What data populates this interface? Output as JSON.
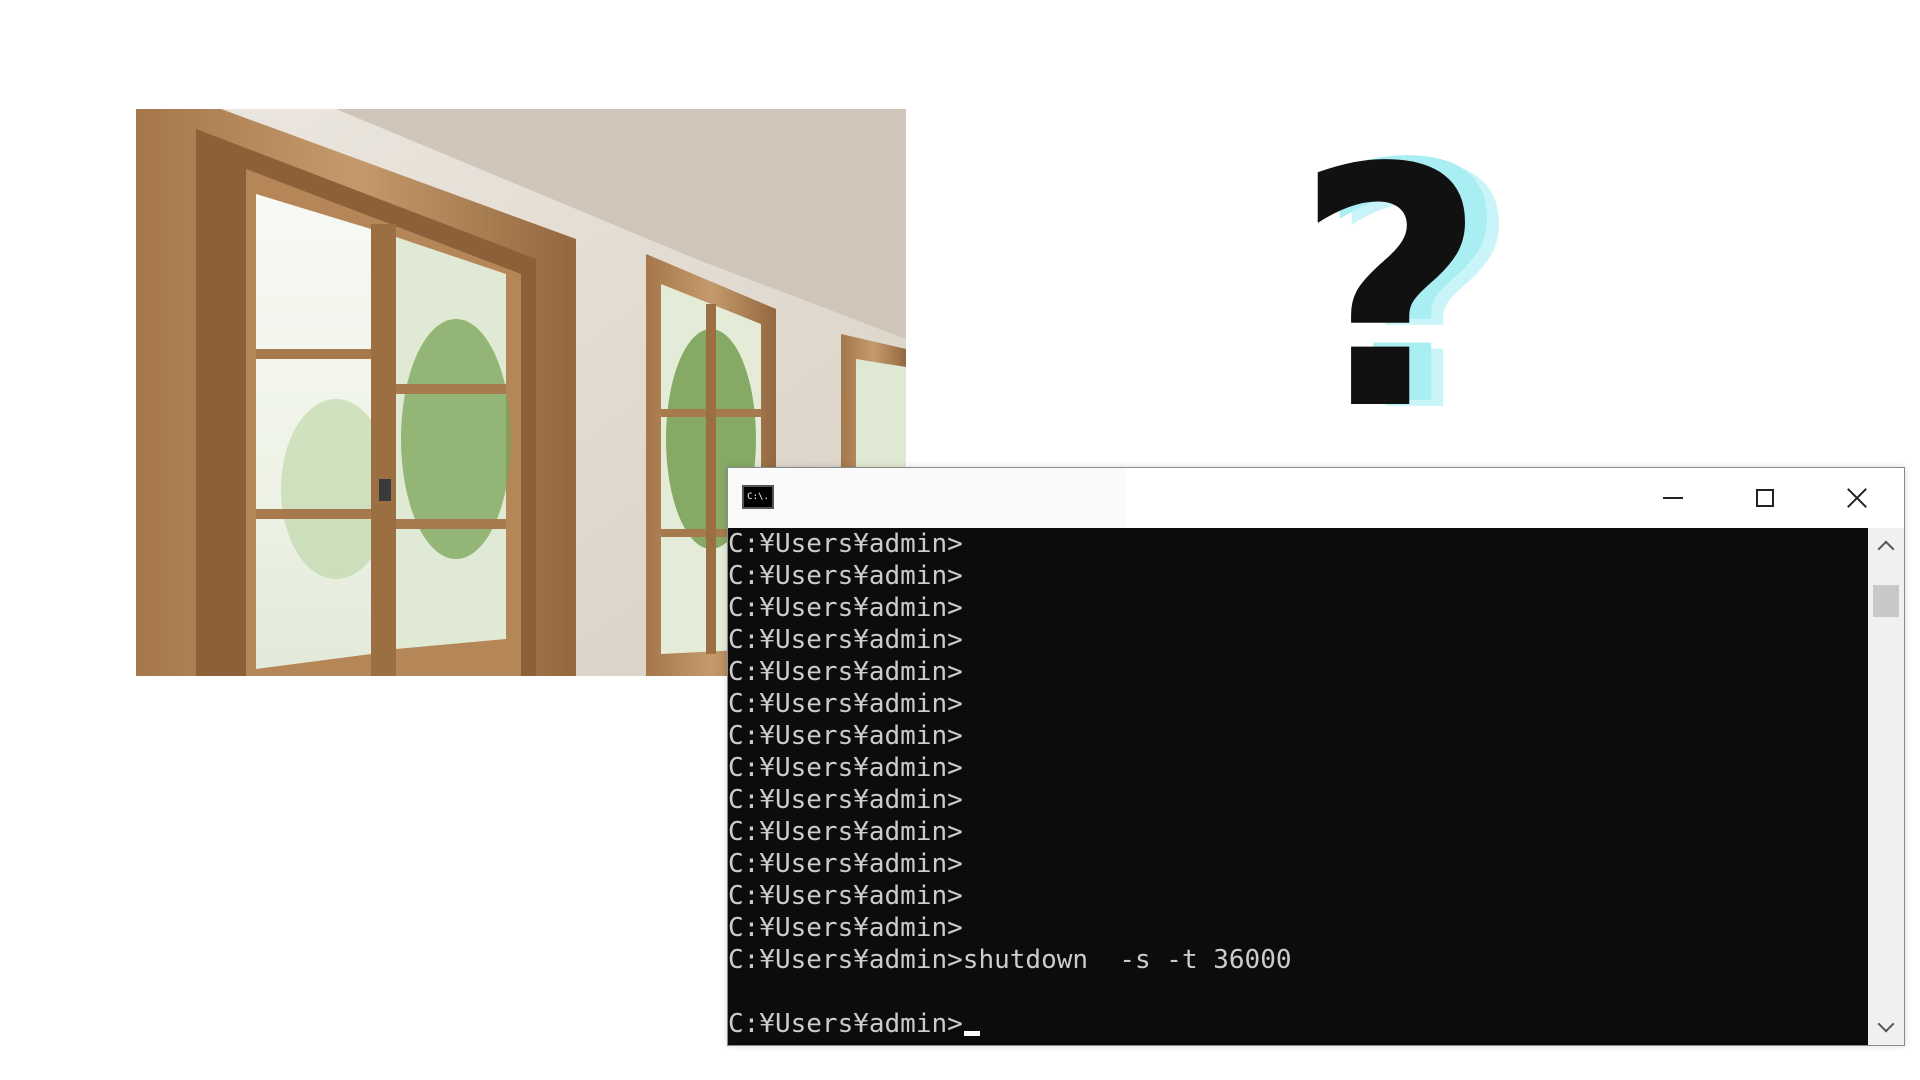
{
  "photo": {
    "subject": "room-with-wooden-french-windows"
  },
  "question_mark": {
    "text": "?",
    "colors": {
      "main": "#111111",
      "shadow": "#a8eef3"
    }
  },
  "console": {
    "icon_text": "C:\\.",
    "controls": {
      "minimize": "minimize-icon",
      "maximize": "maximize-icon",
      "close": "close-icon"
    },
    "lines": [
      "C:¥Users¥admin>",
      "C:¥Users¥admin>",
      "C:¥Users¥admin>",
      "C:¥Users¥admin>",
      "C:¥Users¥admin>",
      "C:¥Users¥admin>",
      "C:¥Users¥admin>",
      "C:¥Users¥admin>",
      "C:¥Users¥admin>",
      "C:¥Users¥admin>",
      "C:¥Users¥admin>",
      "C:¥Users¥admin>",
      "C:¥Users¥admin>",
      "C:¥Users¥admin>shutdown  -s -t 36000",
      "",
      "C:¥Users¥admin>"
    ],
    "colors": {
      "background": "#0c0c0c",
      "text": "#cccccc"
    }
  }
}
